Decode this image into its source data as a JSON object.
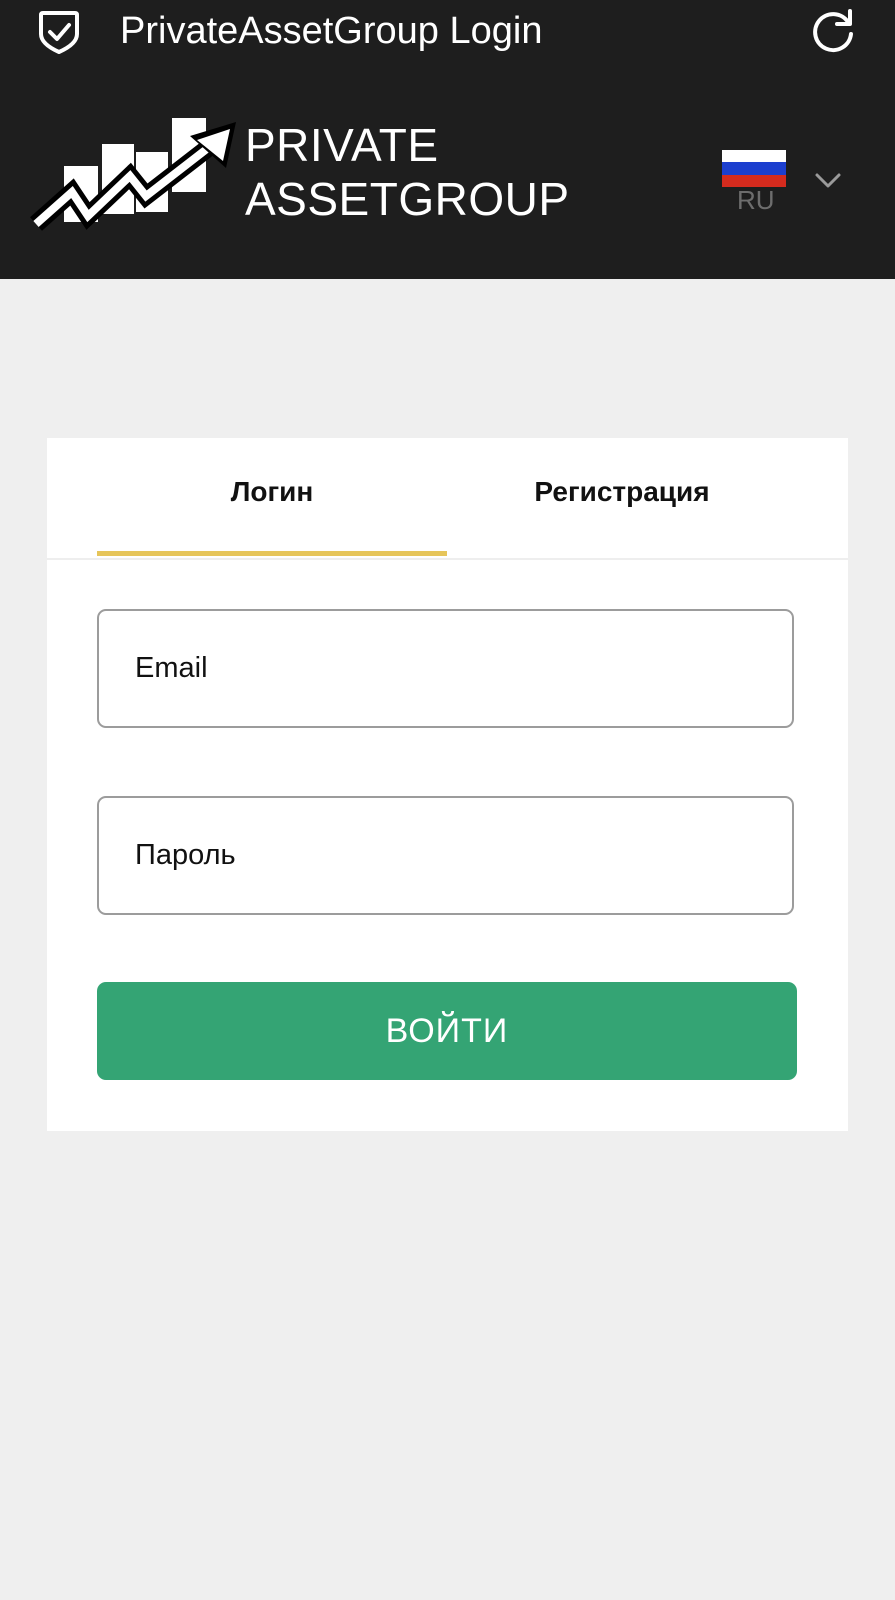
{
  "window": {
    "title": "PrivateAssetGroup Login"
  },
  "header": {
    "logo_line1": "PRIVATE",
    "logo_line2": "ASSETGROUP",
    "language": {
      "code": "RU",
      "flag_colors": [
        "#ffffff",
        "#1c3fcf",
        "#d52b1e"
      ]
    }
  },
  "auth_card": {
    "tabs": [
      {
        "label": "Логин",
        "active": true
      },
      {
        "label": "Регистрация",
        "active": false
      }
    ],
    "email_placeholder": "Email",
    "password_placeholder": "Пароль",
    "submit_label": "ВОЙТИ"
  },
  "colors": {
    "header_bg": "#1e1e1e",
    "page_bg": "#efefef",
    "accent_tab": "#e6c55a",
    "primary_button": "#34a474"
  },
  "icons": {
    "status": "shield-check-icon",
    "reload": "refresh-icon",
    "language_dropdown": "chevron-down-icon"
  }
}
